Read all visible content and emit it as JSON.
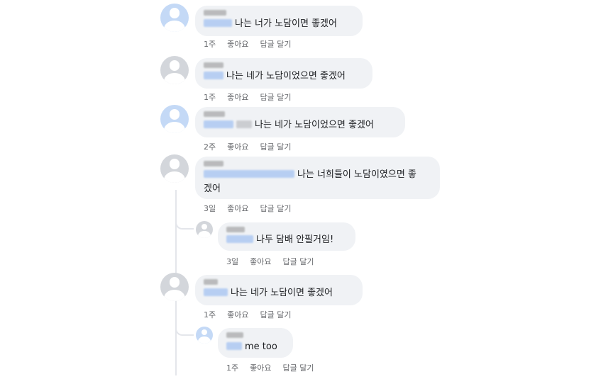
{
  "comments": [
    {
      "text": "나는 너가 노담이면 좋겠어",
      "time": "1주",
      "like": "좋아요",
      "reply": "답글 달기"
    },
    {
      "text": "나는 네가 노담이었으면 좋겠어",
      "time": "1주",
      "like": "좋아요",
      "reply": "답글 달기"
    },
    {
      "text": "나는 네가 노담이었으면 좋겠어",
      "time": "2주",
      "like": "좋아요",
      "reply": "답글 달기"
    },
    {
      "text_line1": "나는 너희들이 노담이였으면 좋",
      "text_line2": "겠어",
      "time": "3일",
      "like": "좋아요",
      "reply": "답글 달기"
    },
    {
      "text": "나두 담배 안필거임!",
      "time": "3일",
      "like": "좋아요",
      "reply": "답글 달기"
    },
    {
      "text": "나는 네가 노담이면 좋겠어",
      "time": "1주",
      "like": "좋아요",
      "reply": "답글 달기"
    },
    {
      "text": "me too",
      "time": "1주",
      "like": "좋아요",
      "reply": "답글 달기"
    }
  ],
  "colors": {
    "bubble": "#f0f2f5",
    "mention": "#a9c6f2",
    "meta": "#65676b"
  },
  "avatar_icon": "default-profile-icon"
}
